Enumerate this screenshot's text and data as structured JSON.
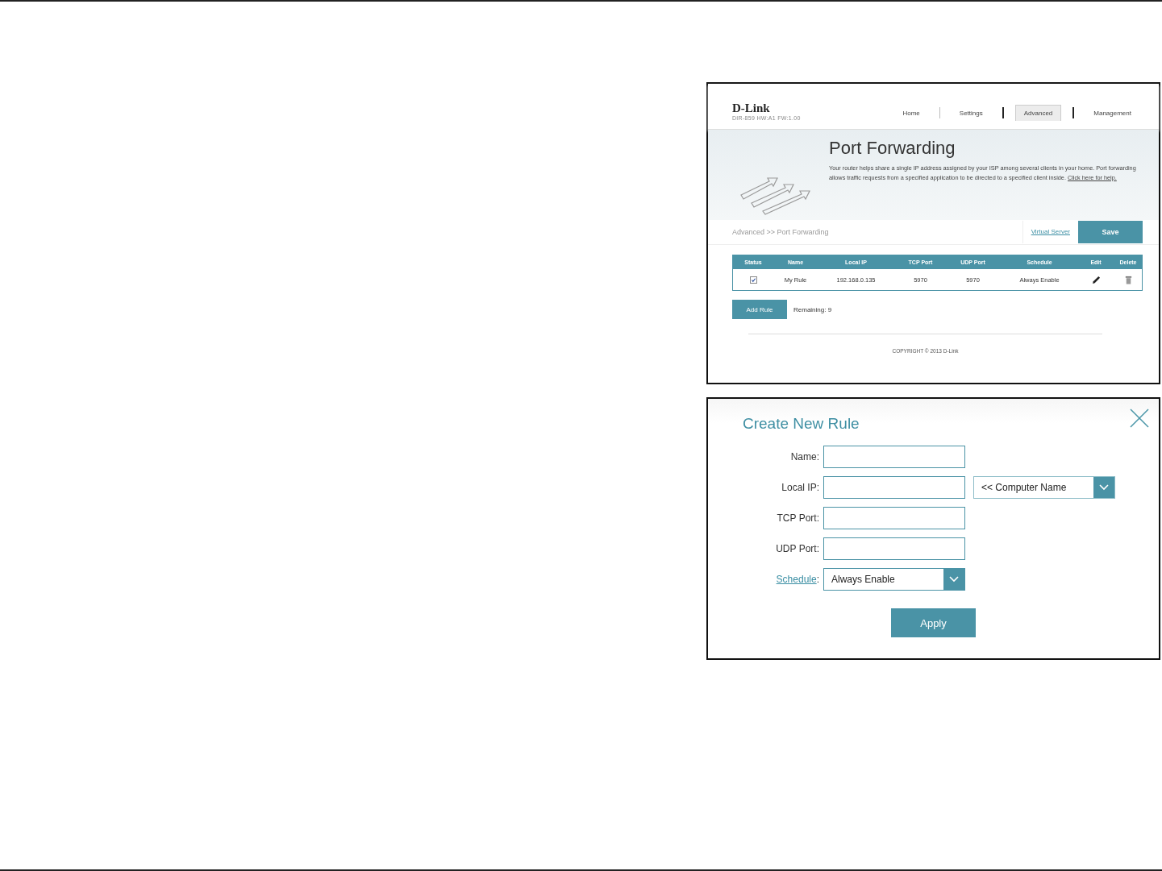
{
  "router_page": {
    "brand": "D-Link",
    "model_info": "DIR-859   HW:A1   FW:1.00",
    "nav": [
      {
        "label": "Home",
        "selected": false
      },
      {
        "label": "Settings",
        "selected": false
      },
      {
        "label": "Advanced",
        "selected": true
      },
      {
        "label": "Management",
        "selected": false
      }
    ],
    "title": "Port Forwarding",
    "description": "Your router helps share a single IP address assigned by your ISP among several clients in your home. Port forwarding allows traffic requests from a specified application to be directed to a specified client inside.",
    "help_link": "Click here for help.",
    "breadcrumb": "Advanced >> Port Forwarding",
    "virtual_server_link": "Virtual Server",
    "save_button": "Save",
    "table": {
      "columns": [
        "Status",
        "Name",
        "Local IP",
        "TCP Port",
        "UDP Port",
        "Schedule",
        "Edit",
        "Delete"
      ],
      "rows": [
        {
          "checked": true,
          "name": "My Rule",
          "local_ip": "192.168.0.135",
          "tcp_port": "5970",
          "udp_port": "5970",
          "schedule": "Always Enable"
        }
      ]
    },
    "add_rule_button": "Add Rule",
    "remaining": "Remaining: 9",
    "copyright": "COPYRIGHT © 2013 D-Link"
  },
  "create_rule_dialog": {
    "title": "Create New Rule",
    "fields": [
      {
        "kind": "text",
        "label": "Name:"
      },
      {
        "kind": "text",
        "label": "Local IP:",
        "picker": "<< Computer Name"
      },
      {
        "kind": "text",
        "label": "TCP Port:"
      },
      {
        "kind": "text",
        "label": "UDP Port:"
      },
      {
        "kind": "select",
        "label": "Schedule",
        "label_suffix": ":",
        "value": "Always Enable"
      }
    ],
    "apply_button": "Apply"
  }
}
